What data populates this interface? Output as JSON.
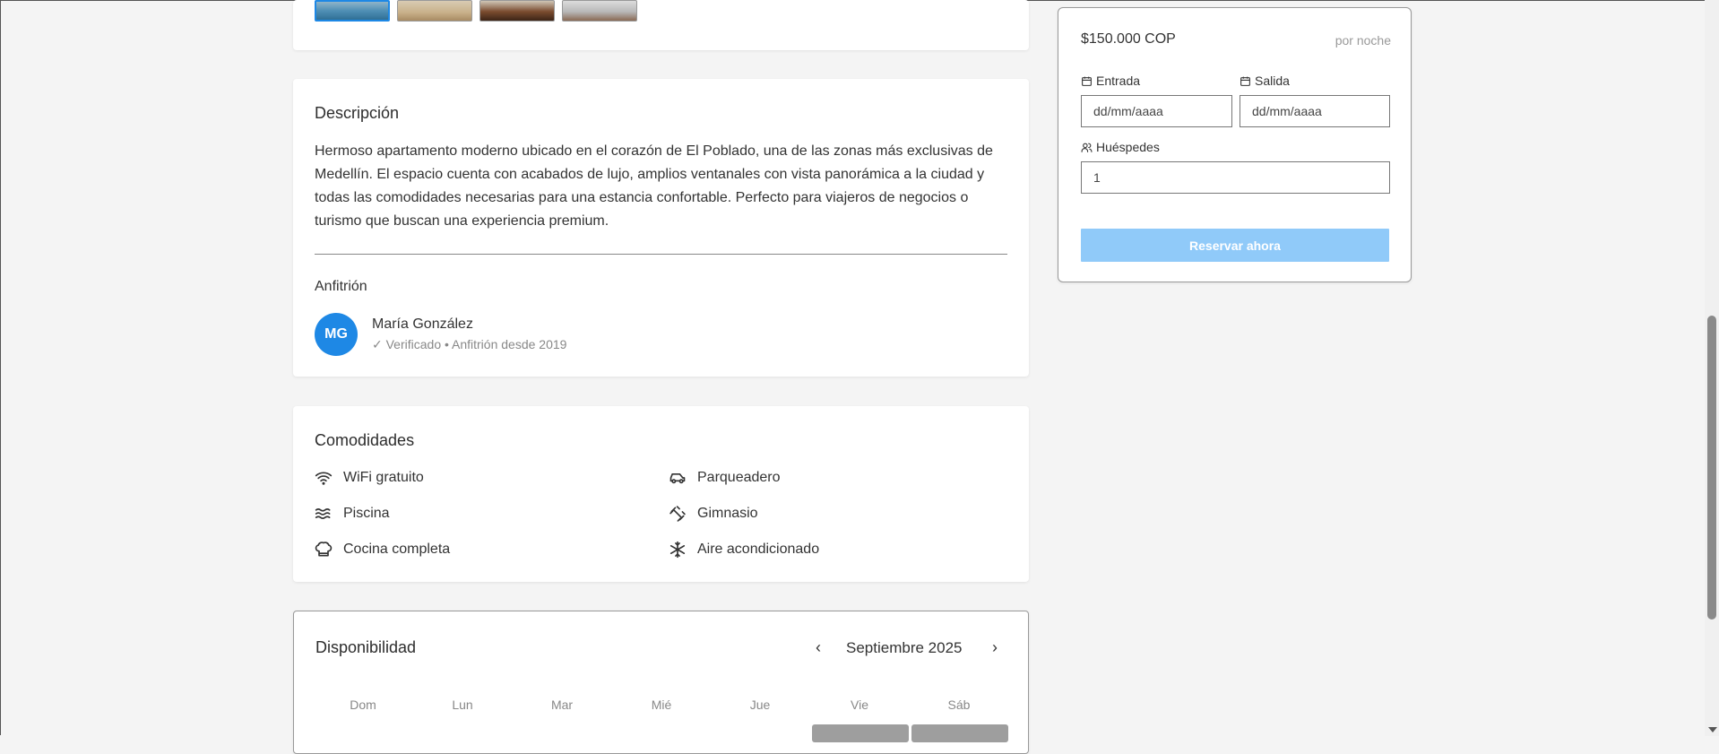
{
  "gallery": {
    "thumbnails": [
      "thumb-1",
      "thumb-2",
      "thumb-3",
      "thumb-4"
    ]
  },
  "description": {
    "title": "Descripción",
    "text": "Hermoso apartamento moderno ubicado en el corazón de El Poblado, una de las zonas más exclusivas de Medellín. El espacio cuenta con acabados de lujo, amplios ventanales con vista panorámica a la ciudad y todas las comodidades necesarias para una estancia confortable. Perfecto para viajeros de negocios o turismo que buscan una experiencia premium."
  },
  "host": {
    "title": "Anfitrión",
    "initials": "MG",
    "name": "María González",
    "meta": "✓ Verificado • Anfitrión desde 2019"
  },
  "amenities": {
    "title": "Comodidades",
    "items": [
      {
        "label": "WiFi gratuito",
        "icon": "wifi-icon"
      },
      {
        "label": "Parqueadero",
        "icon": "car-icon"
      },
      {
        "label": "Piscina",
        "icon": "waves-icon"
      },
      {
        "label": "Gimnasio",
        "icon": "dumbbell-icon"
      },
      {
        "label": "Cocina completa",
        "icon": "chef-hat-icon"
      },
      {
        "label": "Aire acondicionado",
        "icon": "snowflake-icon"
      }
    ]
  },
  "availability": {
    "title": "Disponibilidad",
    "month": "Septiembre 2025",
    "prev": "‹",
    "next": "›",
    "weekdays": [
      "Dom",
      "Lun",
      "Mar",
      "Mié",
      "Jue",
      "Vie",
      "Sáb"
    ]
  },
  "booking": {
    "price": "$150.000 COP",
    "per_night": "por noche",
    "checkin_label": "Entrada",
    "checkout_label": "Salida",
    "checkin_placeholder": "dd/mm/aaaa",
    "checkout_placeholder": "dd/mm/aaaa",
    "guests_label": "Huéspedes",
    "guests_value": "1",
    "reserve_label": "Reservar ahora"
  },
  "colors": {
    "accent": "#1e88e5",
    "button_disabled": "#90caf9",
    "background": "#f4f4f4"
  }
}
